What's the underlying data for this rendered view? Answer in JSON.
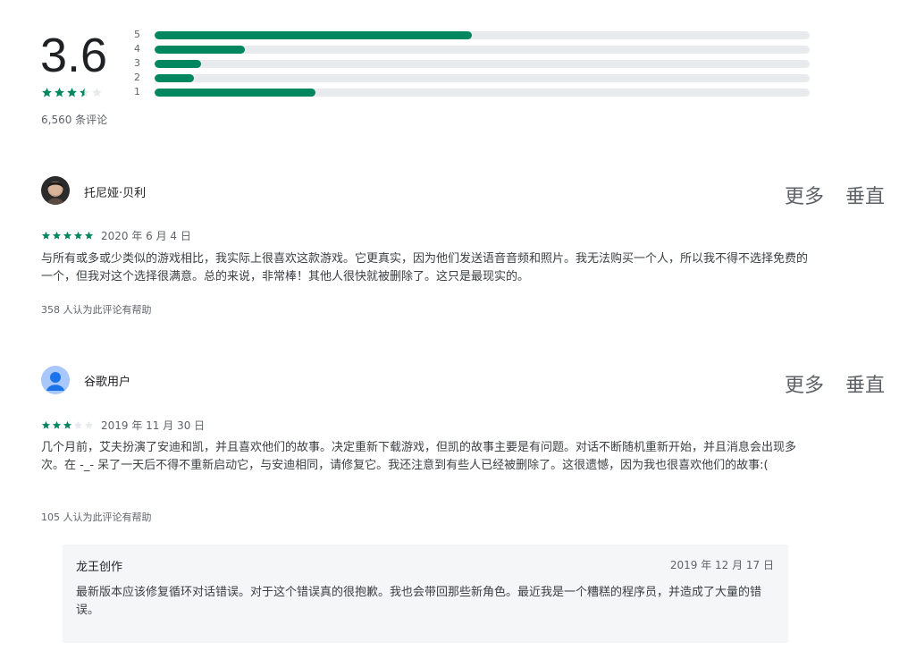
{
  "summary": {
    "score": "3.6",
    "rating_stars": 3.5,
    "count_label": "6,560 条评论",
    "distribution": [
      {
        "label": "5",
        "fraction": 0.484
      },
      {
        "label": "4",
        "fraction": 0.138
      },
      {
        "label": "3",
        "fraction": 0.071
      },
      {
        "label": "2",
        "fraction": 0.06
      },
      {
        "label": "1",
        "fraction": 0.246
      }
    ],
    "accent_color": "#01875f"
  },
  "reviews": [
    {
      "author": "托尼娅·贝利",
      "avatar": "photo-avatar",
      "stars": 5,
      "date": "2020 年 6 月 4 日",
      "text": "与所有或多或少类似的游戏相比，我实际上很喜欢这款游戏。它更真实，因为他们发送语音音频和照片。我无法购买一个人，所以我不得不选择免费的一个，但我对这个选择很满意。总的来说，非常棒！其他人很快就被删除了。这只是最现实的。",
      "helpful": "358 人认为此评论有帮助",
      "more_label": "更多",
      "vertical_label": "垂直"
    },
    {
      "author": "谷歌用户",
      "avatar": "default-user-icon",
      "stars": 3,
      "date": "2019 年 11 月 30 日",
      "text": "几个月前，艾夫扮演了安迪和凯，并且喜欢他们的故事。决定重新下载游戏，但凯的故事主要是有问题。对话不断随机重新开始，并且消息会出现多次。在 -_- 呆了一天后不得不重新启动它，与安迪相同，请修复它。我还注意到有些人已经被删除了。这很遗憾，因为我也很喜欢他们的故事:(",
      "helpful": "105 人认为此评论有帮助",
      "more_label": "更多",
      "vertical_label": "垂直",
      "reply": {
        "author": "龙王创作",
        "date": "2019 年 12 月 17 日",
        "text": "最新版本应该修复循环对话错误。对于这个错误真的很抱歉。我也会带回那些新角色。最近我是一个糟糕的程序员，并造成了大量的错误。"
      }
    }
  ]
}
